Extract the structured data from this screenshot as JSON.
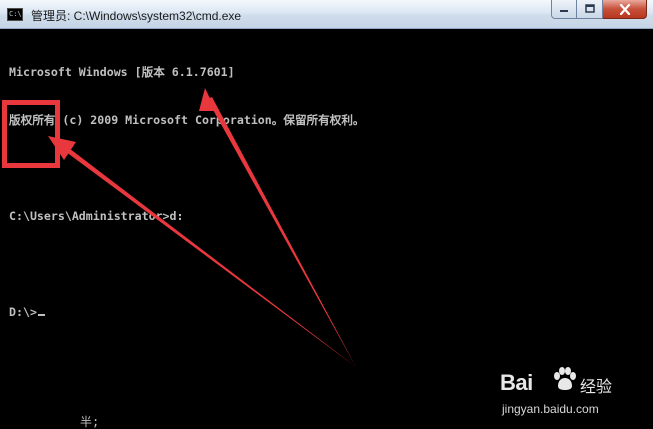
{
  "window": {
    "title": "管理员: C:\\Windows\\system32\\cmd.exe",
    "icon": "cmd-icon",
    "background_color": "#000000",
    "text_color": "#c0c0c0",
    "buttons": {
      "minimize": "minimize-icon",
      "maximize": "maximize-icon",
      "close": "close-icon"
    }
  },
  "console": {
    "lines": [
      "Microsoft Windows [版本 6.1.7601]",
      "版权所有 (c) 2009 Microsoft Corporation。保留所有权利。",
      "",
      "C:\\Users\\Administrator>d:",
      "",
      "D:\\>"
    ]
  },
  "overlay_fragment": "半;",
  "annotation": {
    "color": "#e8383d"
  },
  "watermark": {
    "brand": "Bai",
    "brand_suffix": "经验",
    "url": "jingyan.baidu.com"
  }
}
